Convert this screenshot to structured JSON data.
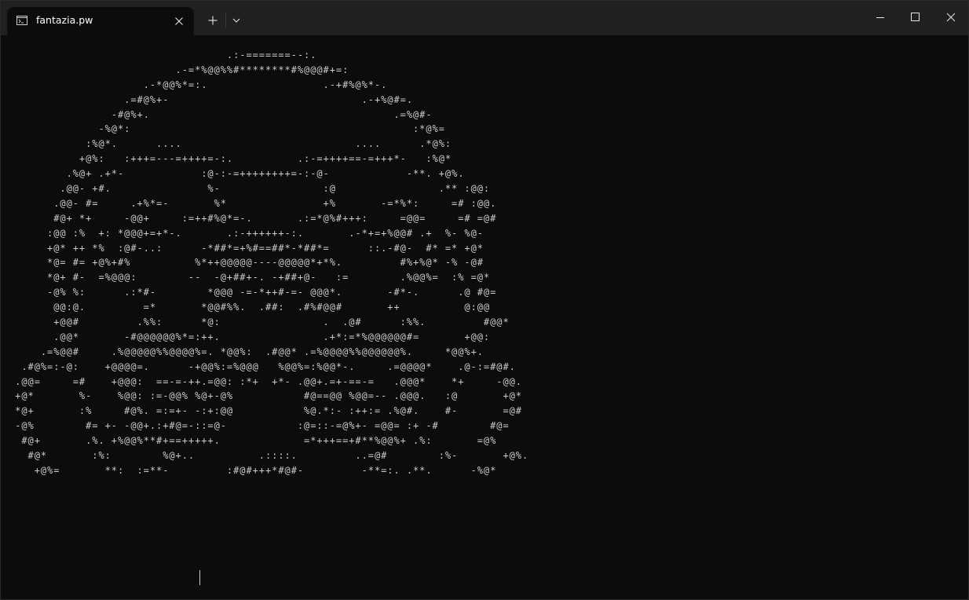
{
  "window": {
    "tab_title": "fantazia.pw",
    "tab_icon": "terminal-icon",
    "close_tab_icon": "close-icon",
    "new_tab_icon": "plus-icon",
    "dropdown_icon": "chevron-down-icon",
    "minimize_icon": "minimize-icon",
    "maximize_icon": "maximize-icon",
    "close_window_icon": "close-icon"
  },
  "colors": {
    "background": "#0c0c0c",
    "titlebar": "#202020",
    "text": "#cccccc"
  },
  "terminal": {
    "lines": [
      "                                  .:-=======--:.",
      "                          .-=*%@@%%#********#%@@@#+=:",
      "                     .-*@@%*=:.                  .-+#%@%*-.",
      "                  .=#@%+-                              .-+%@#=.",
      "                -#@%+.                                      .=%@#-",
      "              -%@*:                                            :*@%=",
      "            :%@*.      ....                           ....      .*@%:",
      "           +@%:   :+++=---=++++=-:.          .:-=++++==-=+++*-   :%@*",
      "         .%@+ .+*-            :@-:-=++++++++=-:-@-            -**. +@%.",
      "        .@@- +#.               %-                :@                .** :@@:",
      "       .@@- #=     .+%*=-       %*               +%       -=*%*:     =# :@@.",
      "       #@+ *+     -@@+     :=++#%@*=-.       .:=*@%#+++:     =@@=     =# =@#",
      "      :@@ :%  +: *@@@+=+*-.       .:-++++++-:.       .-*+=+%@@# .+  %- %@-",
      "      +@* ++ *%  :@#-..:      -*##*=+%#==##*-*##*=      ::.-#@-  #* =* +@*",
      "      *@= #= +@%+#%          %*++@@@@@----@@@@@*+*%.         #%+%@* -% -@#",
      "      *@+ #-  =%@@@:        --  -@+##+-. -+##+@-   :=        .%@@%=  :% =@*",
      "      -@% %:      .:*#-        *@@@ -=-*++#-=- @@@*.       -#*-.      .@ #@=",
      "       @@:@.         =*       *@@#%%.  .##:  .#%#@@#       ++          @:@@",
      "       +@@#         .%%:      *@:                .  .@#      :%%.         #@@*",
      "       .@@*       -#@@@@@@%*=:++.                .+*:=*%@@@@@@#=       +@@:",
      "     .=%@@#     .%@@@@@%%@@@@%=. *@@%:  .#@@* .=%@@@@%%@@@@@@%.     *@@%+.",
      "  .#@%=:-@:    +@@@@=.      -+@@%:=%@@@   %@@%=:%@@*-.     .=@@@@*    .@-:=#@#.",
      " .@@=     =#    +@@@:  ==-=-++.=@@: :*+  +*- .@@+.=+-==-=   .@@@*    *+     -@@.",
      " +@*       %-    %@@: :=-@@% %@+-@%           #@==@@ %@@=-- .@@@.   :@       +@*",
      " *@+       :%     #@%. =:=+- -:+:@@           %@.*:- :++:= .%@#.    #-       =@#",
      " -@%        #= +- -@@+.:+#@=-::=@-           :@=::-=@%+- =@@= :+ -#        #@=",
      "  #@+       .%. +%@@%**#+==+++++.             =*+++==+#**%@@%+ .%:       =@%",
      "   #@*       :%:        %@+..          .::::.         ..=@#        :%-       +@%.",
      "    +@%=       **:  :=**-         :#@#+++*#@#-         -**=:. .**.      -%@*"
    ]
  }
}
